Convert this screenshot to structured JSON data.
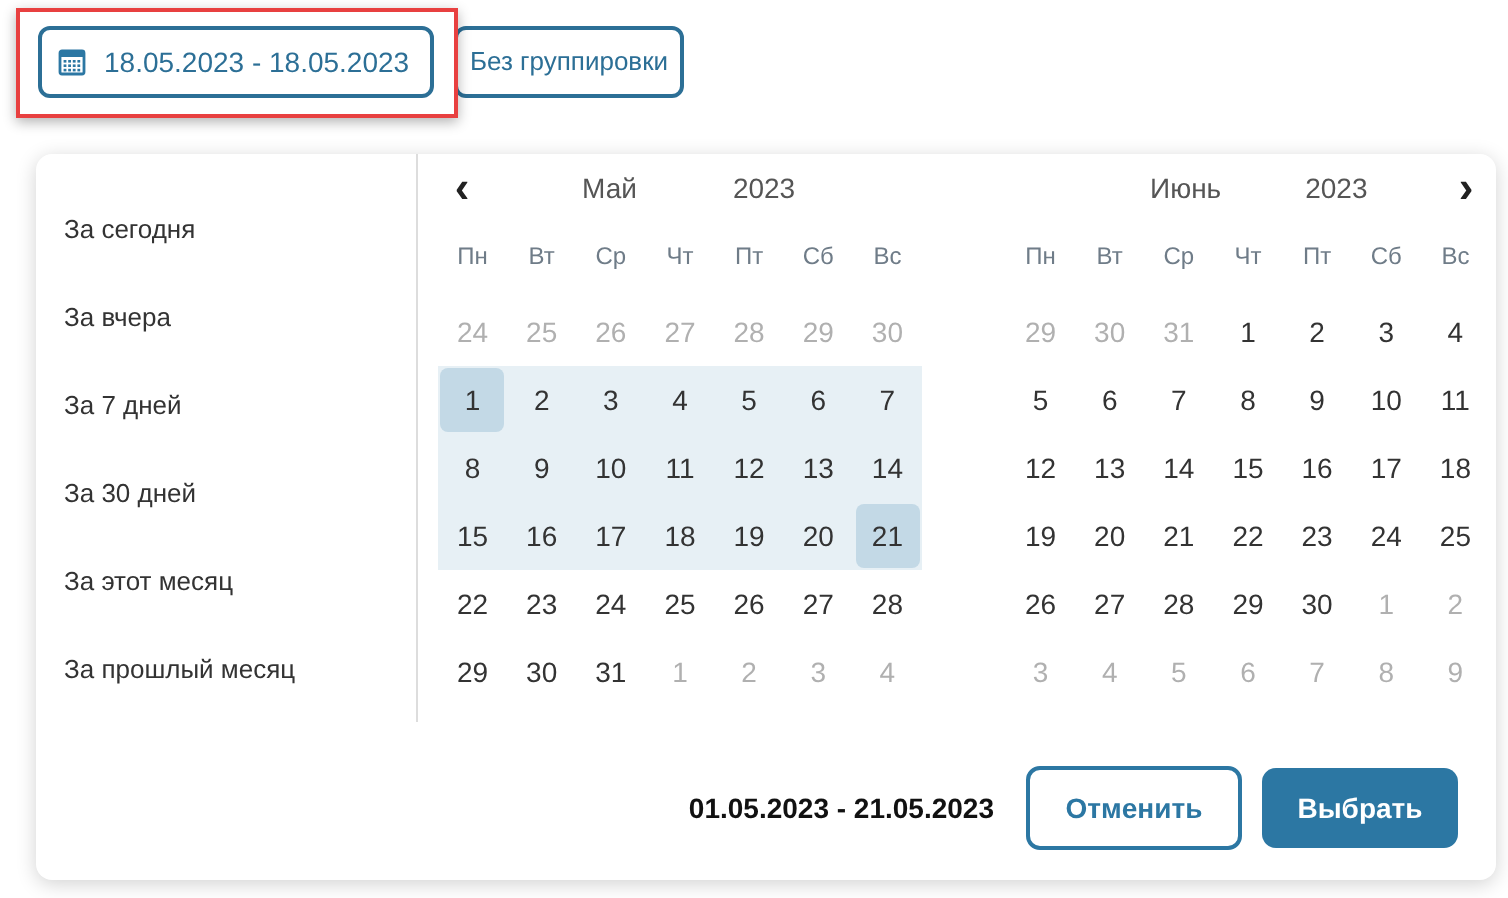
{
  "toolbar": {
    "date_range": "18.05.2023 - 18.05.2023",
    "grouping": "Без группировки",
    "highlighted": true
  },
  "presets": [
    {
      "label": "За сегодня"
    },
    {
      "label": "За вчера"
    },
    {
      "label": "За 7 дней"
    },
    {
      "label": "За 30 дней"
    },
    {
      "label": "За этот месяц"
    },
    {
      "label": "За прошлый месяц"
    }
  ],
  "nav": {
    "prev": "‹",
    "next": "›"
  },
  "months": [
    {
      "month": "Май",
      "year": "2023",
      "weekdays": [
        "Пн",
        "Вт",
        "Ср",
        "Чт",
        "Пт",
        "Сб",
        "Вс"
      ],
      "weeks": [
        [
          {
            "day": "24",
            "kind": "other",
            "in_range": false,
            "selected": false
          },
          {
            "day": "25",
            "kind": "other",
            "in_range": false,
            "selected": false
          },
          {
            "day": "26",
            "kind": "other",
            "in_range": false,
            "selected": false
          },
          {
            "day": "27",
            "kind": "other",
            "in_range": false,
            "selected": false
          },
          {
            "day": "28",
            "kind": "other",
            "in_range": false,
            "selected": false
          },
          {
            "day": "29",
            "kind": "other",
            "in_range": false,
            "selected": false
          },
          {
            "day": "30",
            "kind": "other",
            "in_range": false,
            "selected": false
          }
        ],
        [
          {
            "day": "1",
            "kind": "current",
            "in_range": true,
            "selected": true
          },
          {
            "day": "2",
            "kind": "current",
            "in_range": true,
            "selected": false
          },
          {
            "day": "3",
            "kind": "current",
            "in_range": true,
            "selected": false
          },
          {
            "day": "4",
            "kind": "current",
            "in_range": true,
            "selected": false
          },
          {
            "day": "5",
            "kind": "current",
            "in_range": true,
            "selected": false
          },
          {
            "day": "6",
            "kind": "current",
            "in_range": true,
            "selected": false
          },
          {
            "day": "7",
            "kind": "current",
            "in_range": true,
            "selected": false
          }
        ],
        [
          {
            "day": "8",
            "kind": "current",
            "in_range": true,
            "selected": false
          },
          {
            "day": "9",
            "kind": "current",
            "in_range": true,
            "selected": false
          },
          {
            "day": "10",
            "kind": "current",
            "in_range": true,
            "selected": false
          },
          {
            "day": "11",
            "kind": "current",
            "in_range": true,
            "selected": false
          },
          {
            "day": "12",
            "kind": "current",
            "in_range": true,
            "selected": false
          },
          {
            "day": "13",
            "kind": "current",
            "in_range": true,
            "selected": false
          },
          {
            "day": "14",
            "kind": "current",
            "in_range": true,
            "selected": false
          }
        ],
        [
          {
            "day": "15",
            "kind": "current",
            "in_range": true,
            "selected": false
          },
          {
            "day": "16",
            "kind": "current",
            "in_range": true,
            "selected": false
          },
          {
            "day": "17",
            "kind": "current",
            "in_range": true,
            "selected": false
          },
          {
            "day": "18",
            "kind": "current",
            "in_range": true,
            "selected": false
          },
          {
            "day": "19",
            "kind": "current",
            "in_range": true,
            "selected": false
          },
          {
            "day": "20",
            "kind": "current",
            "in_range": true,
            "selected": false
          },
          {
            "day": "21",
            "kind": "current",
            "in_range": true,
            "selected": true
          }
        ],
        [
          {
            "day": "22",
            "kind": "current",
            "in_range": false,
            "selected": false
          },
          {
            "day": "23",
            "kind": "current",
            "in_range": false,
            "selected": false
          },
          {
            "day": "24",
            "kind": "current",
            "in_range": false,
            "selected": false
          },
          {
            "day": "25",
            "kind": "current",
            "in_range": false,
            "selected": false
          },
          {
            "day": "26",
            "kind": "current",
            "in_range": false,
            "selected": false
          },
          {
            "day": "27",
            "kind": "current",
            "in_range": false,
            "selected": false
          },
          {
            "day": "28",
            "kind": "current",
            "in_range": false,
            "selected": false
          }
        ],
        [
          {
            "day": "29",
            "kind": "current",
            "in_range": false,
            "selected": false
          },
          {
            "day": "30",
            "kind": "current",
            "in_range": false,
            "selected": false
          },
          {
            "day": "31",
            "kind": "current",
            "in_range": false,
            "selected": false
          },
          {
            "day": "1",
            "kind": "other",
            "in_range": false,
            "selected": false
          },
          {
            "day": "2",
            "kind": "other",
            "in_range": false,
            "selected": false
          },
          {
            "day": "3",
            "kind": "other",
            "in_range": false,
            "selected": false
          },
          {
            "day": "4",
            "kind": "other",
            "in_range": false,
            "selected": false
          }
        ]
      ]
    },
    {
      "month": "Июнь",
      "year": "2023",
      "weekdays": [
        "Пн",
        "Вт",
        "Ср",
        "Чт",
        "Пт",
        "Сб",
        "Вс"
      ],
      "weeks": [
        [
          {
            "day": "29",
            "kind": "other",
            "in_range": false,
            "selected": false
          },
          {
            "day": "30",
            "kind": "other",
            "in_range": false,
            "selected": false
          },
          {
            "day": "31",
            "kind": "other",
            "in_range": false,
            "selected": false
          },
          {
            "day": "1",
            "kind": "current",
            "in_range": false,
            "selected": false
          },
          {
            "day": "2",
            "kind": "current",
            "in_range": false,
            "selected": false
          },
          {
            "day": "3",
            "kind": "current",
            "in_range": false,
            "selected": false
          },
          {
            "day": "4",
            "kind": "current",
            "in_range": false,
            "selected": false
          }
        ],
        [
          {
            "day": "5",
            "kind": "current",
            "in_range": false,
            "selected": false
          },
          {
            "day": "6",
            "kind": "current",
            "in_range": false,
            "selected": false
          },
          {
            "day": "7",
            "kind": "current",
            "in_range": false,
            "selected": false
          },
          {
            "day": "8",
            "kind": "current",
            "in_range": false,
            "selected": false
          },
          {
            "day": "9",
            "kind": "current",
            "in_range": false,
            "selected": false
          },
          {
            "day": "10",
            "kind": "current",
            "in_range": false,
            "selected": false
          },
          {
            "day": "11",
            "kind": "current",
            "in_range": false,
            "selected": false
          }
        ],
        [
          {
            "day": "12",
            "kind": "current",
            "in_range": false,
            "selected": false
          },
          {
            "day": "13",
            "kind": "current",
            "in_range": false,
            "selected": false
          },
          {
            "day": "14",
            "kind": "current",
            "in_range": false,
            "selected": false
          },
          {
            "day": "15",
            "kind": "current",
            "in_range": false,
            "selected": false
          },
          {
            "day": "16",
            "kind": "current",
            "in_range": false,
            "selected": false
          },
          {
            "day": "17",
            "kind": "current",
            "in_range": false,
            "selected": false
          },
          {
            "day": "18",
            "kind": "current",
            "in_range": false,
            "selected": false
          }
        ],
        [
          {
            "day": "19",
            "kind": "current",
            "in_range": false,
            "selected": false
          },
          {
            "day": "20",
            "kind": "current",
            "in_range": false,
            "selected": false
          },
          {
            "day": "21",
            "kind": "current",
            "in_range": false,
            "selected": false
          },
          {
            "day": "22",
            "kind": "current",
            "in_range": false,
            "selected": false
          },
          {
            "day": "23",
            "kind": "current",
            "in_range": false,
            "selected": false
          },
          {
            "day": "24",
            "kind": "current",
            "in_range": false,
            "selected": false
          },
          {
            "day": "25",
            "kind": "current",
            "in_range": false,
            "selected": false
          }
        ],
        [
          {
            "day": "26",
            "kind": "current",
            "in_range": false,
            "selected": false
          },
          {
            "day": "27",
            "kind": "current",
            "in_range": false,
            "selected": false
          },
          {
            "day": "28",
            "kind": "current",
            "in_range": false,
            "selected": false
          },
          {
            "day": "29",
            "kind": "current",
            "in_range": false,
            "selected": false
          },
          {
            "day": "30",
            "kind": "current",
            "in_range": false,
            "selected": false
          },
          {
            "day": "1",
            "kind": "other",
            "in_range": false,
            "selected": false
          },
          {
            "day": "2",
            "kind": "other",
            "in_range": false,
            "selected": false
          }
        ],
        [
          {
            "day": "3",
            "kind": "other",
            "in_range": false,
            "selected": false
          },
          {
            "day": "4",
            "kind": "other",
            "in_range": false,
            "selected": false
          },
          {
            "day": "5",
            "kind": "other",
            "in_range": false,
            "selected": false
          },
          {
            "day": "6",
            "kind": "other",
            "in_range": false,
            "selected": false
          },
          {
            "day": "7",
            "kind": "other",
            "in_range": false,
            "selected": false
          },
          {
            "day": "8",
            "kind": "other",
            "in_range": false,
            "selected": false
          },
          {
            "day": "9",
            "kind": "other",
            "in_range": false,
            "selected": false
          }
        ]
      ]
    }
  ],
  "footer": {
    "range": "01.05.2023 - 21.05.2023",
    "cancel": "Отменить",
    "apply": "Выбрать"
  }
}
